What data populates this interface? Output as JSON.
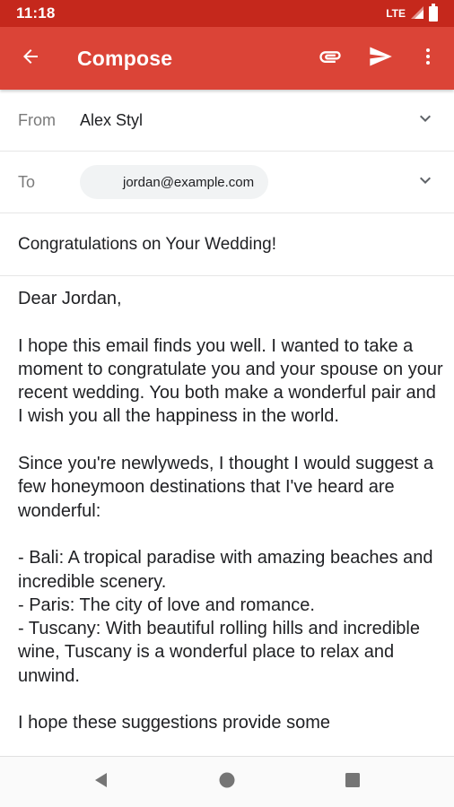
{
  "status_bar": {
    "time": "11:18",
    "network": "LTE"
  },
  "app_bar": {
    "title": "Compose",
    "color": "#db4437",
    "status_color": "#c5281c"
  },
  "from": {
    "label": "From",
    "value": "Alex Styl"
  },
  "to": {
    "label": "To",
    "recipient": "jordan@example.com"
  },
  "subject": "Congratulations on Your Wedding!",
  "body": "Dear Jordan,\n\nI hope this email finds you well. I wanted to take a moment to congratulate you and your spouse on your recent wedding. You both make a wonderful pair and I wish you all the happiness in the world.\n\nSince you're newlyweds, I thought I would suggest a few honeymoon destinations that I've heard are wonderful:\n\n- Bali: A tropical paradise with amazing beaches and incredible scenery.\n- Paris: The city of love and romance.\n- Tuscany: With beautiful rolling hills and incredible wine, Tuscany is a wonderful place to relax and unwind.\n\nI hope these suggestions provide some",
  "icons": {
    "back": "arrow-back-icon",
    "attach": "paperclip-icon",
    "send": "send-icon",
    "more": "more-vert-icon",
    "from_expand": "chevron-down-icon",
    "to_expand": "chevron-down-icon",
    "nav_back": "triangle-back-icon",
    "nav_home": "circle-home-icon",
    "nav_recents": "square-recents-icon"
  }
}
